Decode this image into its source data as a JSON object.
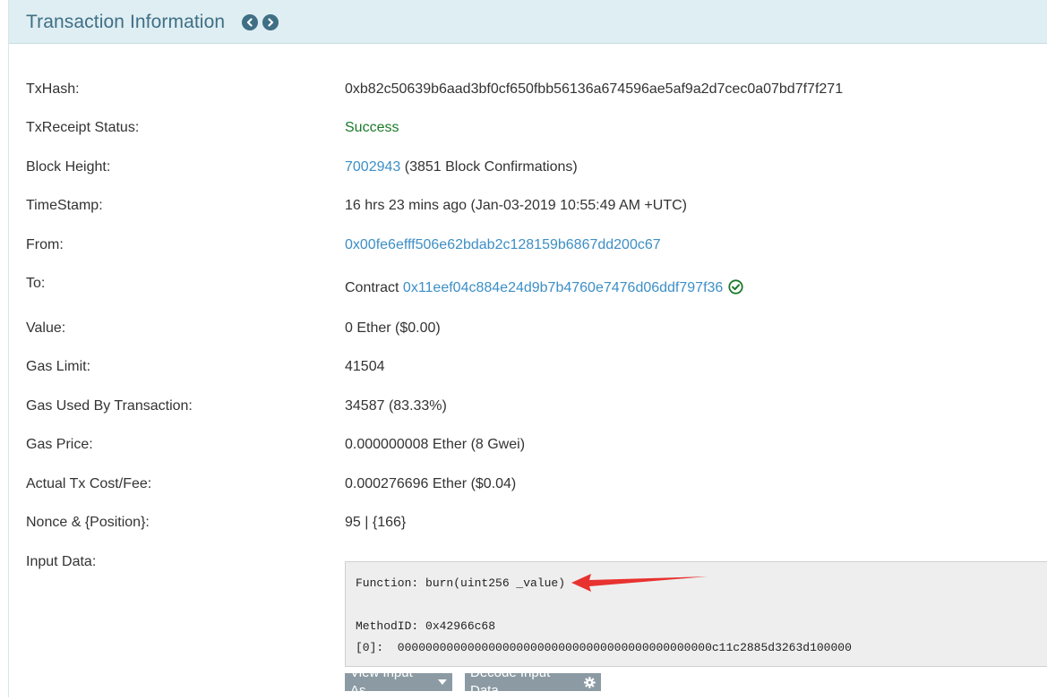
{
  "header": {
    "title": "Transaction Information"
  },
  "rows": {
    "txhash": {
      "label": "TxHash:",
      "value": "0xb82c50639b6aad3bf0cf650fbb56136a674596ae5af9a2d7cec0a07bd7f7f271"
    },
    "status": {
      "label": "TxReceipt Status:",
      "value": "Success"
    },
    "block": {
      "label": "Block Height:",
      "link": "7002943",
      "value": " (3851 Block Confirmations)"
    },
    "timestamp": {
      "label": "TimeStamp:",
      "value": "16 hrs 23 mins ago (Jan-03-2019 10:55:49 AM +UTC)"
    },
    "from": {
      "label": "From:",
      "link": "0x00fe6efff506e62bdab2c128159b6867dd200c67"
    },
    "to": {
      "label": "To:",
      "prefix": "Contract ",
      "link": "0x11eef04c884e24d9b7b4760e7476d06ddf797f36"
    },
    "value": {
      "label": "Value:",
      "value": "0 Ether ($0.00)"
    },
    "gas_limit": {
      "label": "Gas Limit:",
      "value": "41504"
    },
    "gas_used": {
      "label": "Gas Used By Transaction:",
      "value": "34587 (83.33%)"
    },
    "gas_price": {
      "label": "Gas Price:",
      "value": "0.000000008 Ether (8 Gwei)"
    },
    "fee": {
      "label": "Actual Tx Cost/Fee:",
      "value": "0.000276696 Ether ($0.04)"
    },
    "nonce": {
      "label": "Nonce & {Position}:",
      "value": "95 | {166}"
    },
    "input": {
      "label": "Input Data:"
    }
  },
  "input_data": {
    "function": "Function: burn(uint256 _value)",
    "method_id": "MethodID: 0x42966c68",
    "param0": "[0]:  000000000000000000000000000000000000000000000c11c2885d3263d100000"
  },
  "buttons": {
    "view_input_as": "View Input As",
    "decode_input_data": "Decode Input Data"
  },
  "colors": {
    "header_bg": "#dfeef3",
    "title": "#3f6f85",
    "link": "#3d8fc6",
    "success": "#1a7a2a",
    "arrow": "#e8322f"
  }
}
